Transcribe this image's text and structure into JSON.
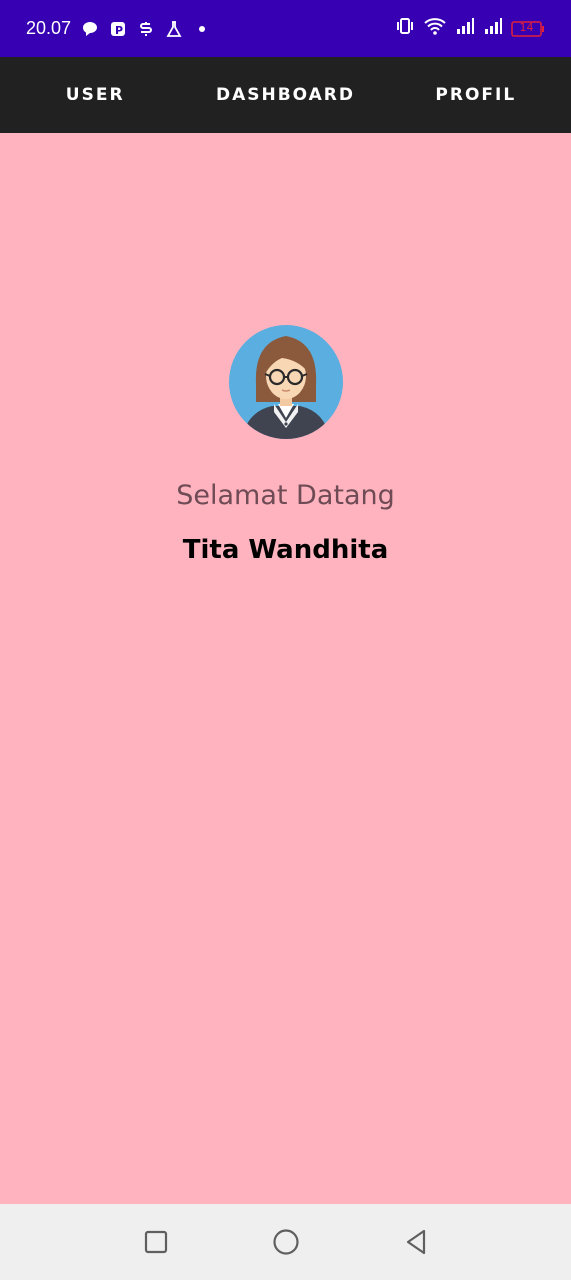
{
  "status_bar": {
    "time": "20.07",
    "notification_icons": [
      "chat-bubble-icon",
      "pdf-app-icon",
      "stack-app-icon",
      "flask-icon",
      "dot-icon"
    ],
    "system_icons": [
      "vibrate-icon",
      "wifi-icon",
      "signal-icon",
      "signal-icon",
      "battery-icon"
    ],
    "battery_level": "14",
    "battery_color": "#e0203a",
    "background_color": "#3700b3"
  },
  "tabs": [
    {
      "label": "USER"
    },
    {
      "label": "DASHBOARD"
    },
    {
      "label": "PROFIL"
    }
  ],
  "main": {
    "greeting": "Selamat Datang",
    "user_name": "Tita Wandhita",
    "avatar_icon": "woman-avatar-icon",
    "background_color": "#ffb3bf"
  },
  "navigation_bar": {
    "buttons": [
      "recents-button",
      "home-button",
      "back-button"
    ]
  }
}
